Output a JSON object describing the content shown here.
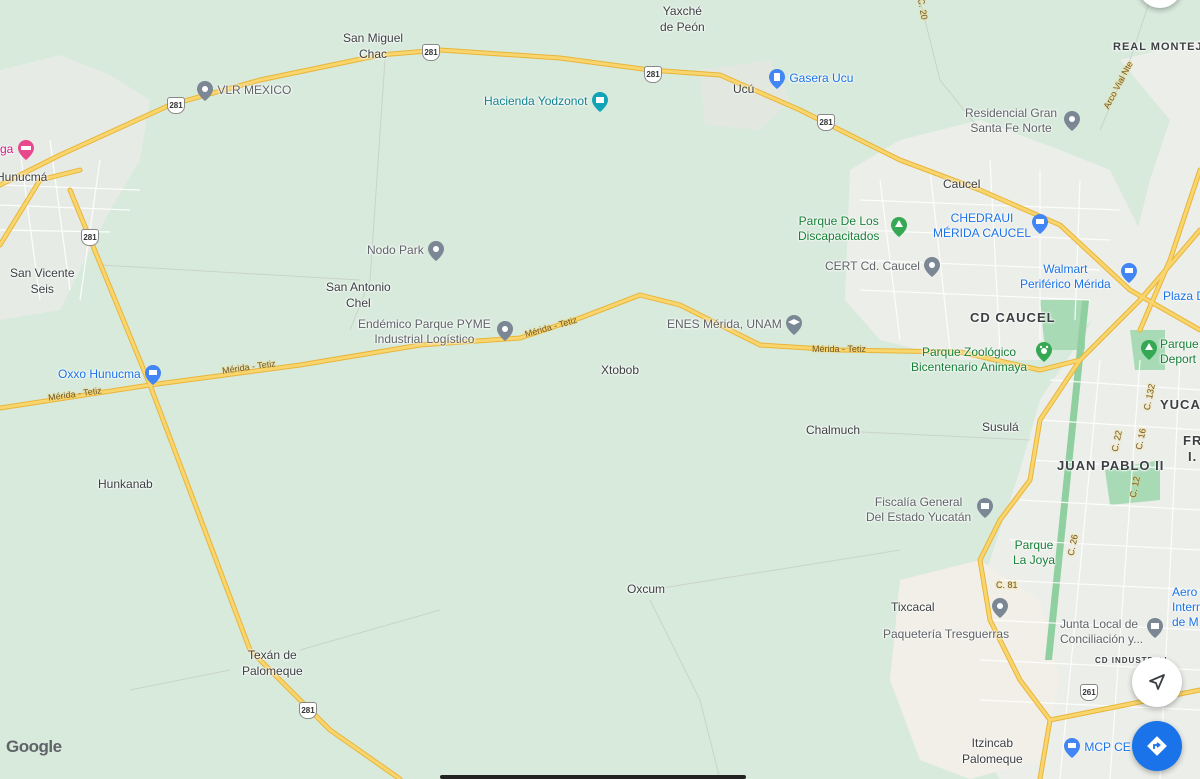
{
  "places": [
    {
      "id": "yaxche",
      "text": "Yaxché\nde Peón"
    },
    {
      "id": "san-miguel-chac",
      "text": "San Miguel\nChac"
    },
    {
      "id": "ucu",
      "text": "Ucú"
    },
    {
      "id": "hunucma",
      "text": "Hunucmá"
    },
    {
      "id": "san-vicente-seis",
      "text": "San Vicente\nSeis"
    },
    {
      "id": "san-antonio-chel",
      "text": "San Antonio\nChel"
    },
    {
      "id": "xtobob",
      "text": "Xtobob"
    },
    {
      "id": "chalmuch",
      "text": "Chalmuch"
    },
    {
      "id": "susula",
      "text": "Susulá"
    },
    {
      "id": "hunkanab",
      "text": "Hunkanab"
    },
    {
      "id": "oxcum",
      "text": "Oxcum"
    },
    {
      "id": "tixcacal",
      "text": "Tixcacal"
    },
    {
      "id": "texan",
      "text": "Texán de\nPalomeque"
    },
    {
      "id": "itzincab",
      "text": "Itzincab\nPalomeque"
    },
    {
      "id": "caucel",
      "text": "Caucel"
    }
  ],
  "districts": [
    {
      "id": "cd-caucel",
      "text": "CD CAUCEL"
    },
    {
      "id": "juan-pablo",
      "text": "JUAN PABLO II"
    },
    {
      "id": "real-montejo",
      "text": "REAL MONTEJO"
    },
    {
      "id": "yuca",
      "text": "YUCA"
    },
    {
      "id": "fr",
      "text": "FR\nI."
    },
    {
      "id": "cd-industrial",
      "text": "CD INDUSTRIAL"
    }
  ],
  "pois": [
    {
      "id": "vlr-mexico",
      "text": "VLR MEXICO",
      "color": "gray",
      "icon": "map-pin-icon"
    },
    {
      "id": "gasera-ucu",
      "text": "Gasera Ucu",
      "color": "blue",
      "icon": "gas-station-icon"
    },
    {
      "id": "hacienda",
      "text": "Hacienda Yodzonot",
      "color": "teal",
      "icon": "landmark-icon"
    },
    {
      "id": "residencial",
      "text": "Residencial Gran\nSanta Fe Norte",
      "color": "gray",
      "icon": "map-pin-icon"
    },
    {
      "id": "parque-disc",
      "text": "Parque De Los\nDiscapacitados",
      "color": "green",
      "icon": "park-icon"
    },
    {
      "id": "chedraui",
      "text": "CHEDRAUI\nMÉRIDA CAUCEL",
      "color": "blue",
      "icon": "shopping-cart-icon"
    },
    {
      "id": "cert",
      "text": "CERT Cd. Caucel",
      "color": "gray",
      "icon": "map-pin-icon"
    },
    {
      "id": "walmart",
      "text": "Walmart\nPeriférico Mérida",
      "color": "blue",
      "icon": "shopping-cart-icon"
    },
    {
      "id": "plaza",
      "text": "Plaza D",
      "color": "blue",
      "icon": "none"
    },
    {
      "id": "nodo-park",
      "text": "Nodo Park",
      "color": "gray",
      "icon": "map-pin-icon"
    },
    {
      "id": "endemico",
      "text": "Endémico Parque PYME\nIndustrial Logístico",
      "color": "gray",
      "icon": "map-pin-icon"
    },
    {
      "id": "enes",
      "text": "ENES Mérida, UNAM",
      "color": "gray",
      "icon": "school-icon"
    },
    {
      "id": "zoologico",
      "text": "Parque Zoológico\nBicentenario Animaya",
      "color": "green",
      "icon": "paw-icon"
    },
    {
      "id": "parque-dep",
      "text": "Parque\nDeport",
      "color": "green",
      "icon": "park-icon"
    },
    {
      "id": "oxxo",
      "text": "Oxxo Hunucma",
      "color": "blue",
      "icon": "shopping-cart-icon"
    },
    {
      "id": "fiscalia",
      "text": "Fiscalía General\nDel Estado Yucatán",
      "color": "gray",
      "icon": "government-icon"
    },
    {
      "id": "parque-joya",
      "text": "Parque\nLa Joya",
      "color": "green",
      "icon": "park-icon"
    },
    {
      "id": "paqueteria",
      "text": "Paquetería Tresguerras",
      "color": "gray",
      "icon": "map-pin-icon"
    },
    {
      "id": "junta",
      "text": "Junta Local de\nConciliación y...",
      "color": "gray",
      "icon": "government-icon"
    },
    {
      "id": "aero",
      "text": "Aero\nIntern\nde M",
      "color": "blue",
      "icon": "none"
    },
    {
      "id": "mcp",
      "text": "MCP CE",
      "color": "blue",
      "icon": "shopping-cart-icon"
    },
    {
      "id": "hotel",
      "text": "ga",
      "color": "pink",
      "icon": "hotel-icon"
    }
  ],
  "road_labels": [
    {
      "id": "merida-tetiz-1",
      "text": "Mérida - Tetiz"
    },
    {
      "id": "merida-tetiz-2",
      "text": "Mérida - Tetiz"
    },
    {
      "id": "merida-tetiz-3",
      "text": "Mérida - Tetiz"
    },
    {
      "id": "merida-tetiz-4",
      "text": "Mérida - Tetiz"
    },
    {
      "id": "arco-vial",
      "text": "Arco Vial Nte"
    },
    {
      "id": "c132",
      "text": "C. 132"
    },
    {
      "id": "c16",
      "text": "C. 16"
    },
    {
      "id": "c22",
      "text": "C. 22"
    },
    {
      "id": "c12",
      "text": "C. 12"
    },
    {
      "id": "c26",
      "text": "C. 26"
    },
    {
      "id": "c81",
      "text": "C. 81"
    },
    {
      "id": "c20",
      "text": "C. 20"
    }
  ],
  "shields": [
    {
      "id": "s1",
      "text": "281"
    },
    {
      "id": "s2",
      "text": "281"
    },
    {
      "id": "s3",
      "text": "281"
    },
    {
      "id": "s4",
      "text": "281"
    },
    {
      "id": "s5",
      "text": "281"
    },
    {
      "id": "s6",
      "text": "281"
    },
    {
      "id": "s7",
      "text": "261"
    }
  ],
  "brand": {
    "logo": "Google"
  },
  "colors": {
    "land": "#d8eadc",
    "urban": "#eceee9",
    "road": "#f9d56e",
    "road_edge": "#e8b53a",
    "park": "#a8dab5",
    "accent": "#1a73e8"
  }
}
